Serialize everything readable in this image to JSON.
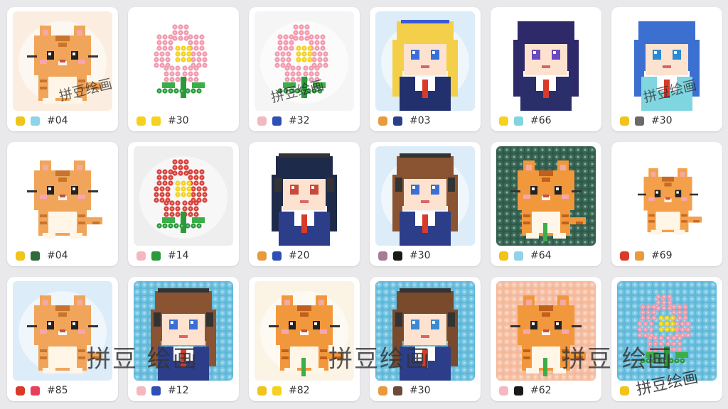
{
  "watermark": {
    "text": "拼豆绘画",
    "big_spaced": "拼豆 绘画",
    "big": "拼豆绘画"
  },
  "cards": [
    {
      "subject": "cat",
      "bg": "#fbeee0",
      "colors": [
        "#f0c419",
        "#8fd3e8"
      ],
      "code": "#04",
      "watermark": true
    },
    {
      "subject": "flower-pink",
      "bg": "#ffffff",
      "colors": [
        "#f4d21f",
        "#f4d21f"
      ],
      "code": "#30"
    },
    {
      "subject": "flower-pink",
      "bg": "#f5f5f5",
      "colors": [
        "#f4b8c0",
        "#2e4fb5"
      ],
      "code": "#32",
      "watermark": true
    },
    {
      "subject": "girl-blonde",
      "bg": "#dcecf8",
      "colors": [
        "#e89a3c",
        "#2c3e8a"
      ],
      "code": "#03"
    },
    {
      "subject": "girl-navy",
      "bg": "#ffffff",
      "colors": [
        "#f4d21f",
        "#7fd6e0"
      ],
      "code": "#66"
    },
    {
      "subject": "girl-blue",
      "bg": "#ffffff",
      "colors": [
        "#f0c419",
        "#6a6a6a"
      ],
      "code": "#30",
      "watermark": true
    },
    {
      "subject": "cat",
      "bg": "#ffffff",
      "colors": [
        "#f0c419",
        "#2e6b3a"
      ],
      "code": "#04"
    },
    {
      "subject": "flower-red",
      "bg": "#eeeeee",
      "colors": [
        "#f4b8c0",
        "#2a9a3a"
      ],
      "code": "#14"
    },
    {
      "subject": "boy-headphones",
      "bg": "#ffffff",
      "colors": [
        "#e89a3c",
        "#2e4fb5"
      ],
      "code": "#20"
    },
    {
      "subject": "girl-brown",
      "bg": "#dcecf8",
      "colors": [
        "#a67b97",
        "#1a1a1a"
      ],
      "code": "#30"
    },
    {
      "subject": "cat-orange",
      "bg": "#2f5a4a",
      "colors": [
        "#f0c419",
        "#8fd3e8"
      ],
      "code": "#64"
    },
    {
      "subject": "cat-small",
      "bg": "#ffffff",
      "colors": [
        "#d93a2a",
        "#e89a3c"
      ],
      "code": "#69"
    },
    {
      "subject": "cat",
      "bg": "#dcecf8",
      "colors": [
        "#d93a2a",
        "#e8405a"
      ],
      "code": "#85"
    },
    {
      "subject": "girl-brown",
      "bg": "#5fb8d8",
      "colors": [
        "#f4b8c0",
        "#2e4fb5"
      ],
      "code": "#12"
    },
    {
      "subject": "cat-orange",
      "bg": "#fbf3e4",
      "colors": [
        "#f0c419",
        "#f4d21f"
      ],
      "code": "#82"
    },
    {
      "subject": "girl-headphones",
      "bg": "#5fb8d8",
      "colors": [
        "#e89a3c",
        "#6b4a3a"
      ],
      "code": "#30"
    },
    {
      "subject": "cat-orange",
      "bg": "#f4b89a",
      "colors": [
        "#f4b8c0",
        "#1a1a1a"
      ],
      "code": "#62"
    },
    {
      "subject": "flower-pink",
      "bg": "#5fb8d8",
      "colors": [
        "#f0c419"
      ],
      "code": ""
    }
  ]
}
